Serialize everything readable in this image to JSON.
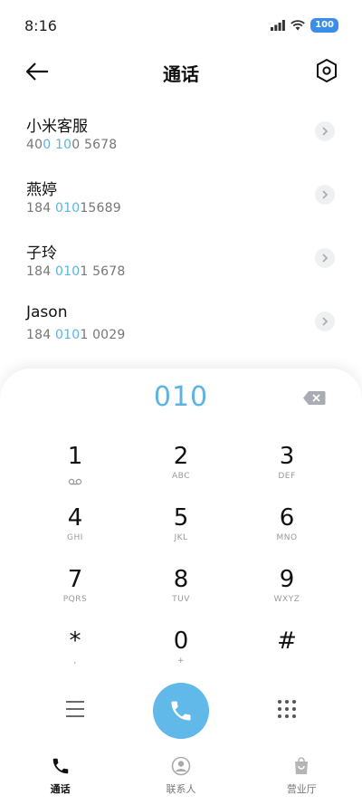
{
  "status": {
    "time": "8:16",
    "battery": "100"
  },
  "header": {
    "title": "通话"
  },
  "contacts": [
    {
      "name": "小米客服",
      "number_parts": [
        "40",
        "0 10",
        "0 5678"
      ]
    },
    {
      "name": "燕婷",
      "number_parts": [
        "184 ",
        "010",
        "15689"
      ]
    },
    {
      "name": "子玲",
      "number_parts": [
        "184 ",
        "010",
        "1 5678"
      ]
    },
    {
      "name": "Jason",
      "number_parts": [
        "184 ",
        "010",
        "1 0029"
      ]
    }
  ],
  "dialpad": {
    "input": "010",
    "keys": [
      {
        "digit": "1",
        "letters": ""
      },
      {
        "digit": "2",
        "letters": "ABC"
      },
      {
        "digit": "3",
        "letters": "DEF"
      },
      {
        "digit": "4",
        "letters": "GHI"
      },
      {
        "digit": "5",
        "letters": "JKL"
      },
      {
        "digit": "6",
        "letters": "MNO"
      },
      {
        "digit": "7",
        "letters": "PQRS"
      },
      {
        "digit": "8",
        "letters": "TUV"
      },
      {
        "digit": "9",
        "letters": "WXYZ"
      },
      {
        "digit": "*",
        "letters": ","
      },
      {
        "digit": "0",
        "letters": "+"
      },
      {
        "digit": "#",
        "letters": ""
      }
    ]
  },
  "tabs": [
    {
      "label": "通话",
      "icon": "phone-icon"
    },
    {
      "label": "联系人",
      "icon": "contact-icon"
    },
    {
      "label": "营业厅",
      "icon": "shopping-bag-icon"
    }
  ],
  "colors": {
    "accent": "#5cb4e4",
    "call_button": "#61b9e9",
    "battery": "#3b8ee8"
  }
}
